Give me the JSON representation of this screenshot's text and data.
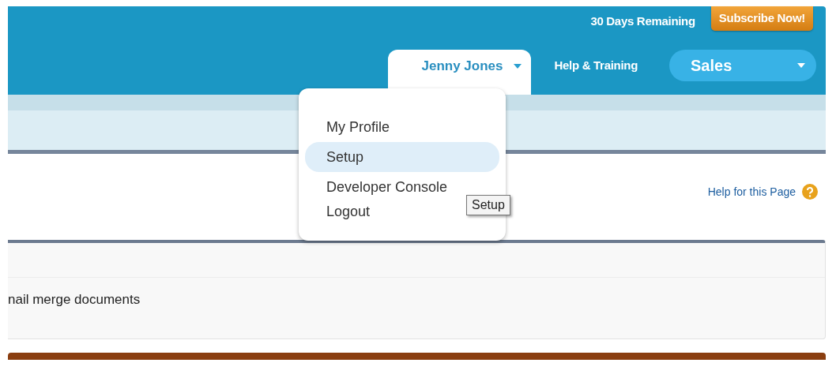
{
  "header": {
    "trial_text": "30 Days Remaining",
    "subscribe_button": "Subscribe Now!",
    "user_menu": {
      "label": "Jenny Jones",
      "expanded": true,
      "items": [
        {
          "label": "My Profile",
          "selected": false
        },
        {
          "label": "Setup",
          "selected": true
        },
        {
          "label": "Developer Console",
          "selected": false
        },
        {
          "label": "Logout",
          "selected": false
        }
      ]
    },
    "help_link": "Help & Training",
    "app_menu": "Sales"
  },
  "tooltip": "Setup",
  "help_for_page": "Help for this Page",
  "panel": {
    "description": "nail merge documents"
  }
}
